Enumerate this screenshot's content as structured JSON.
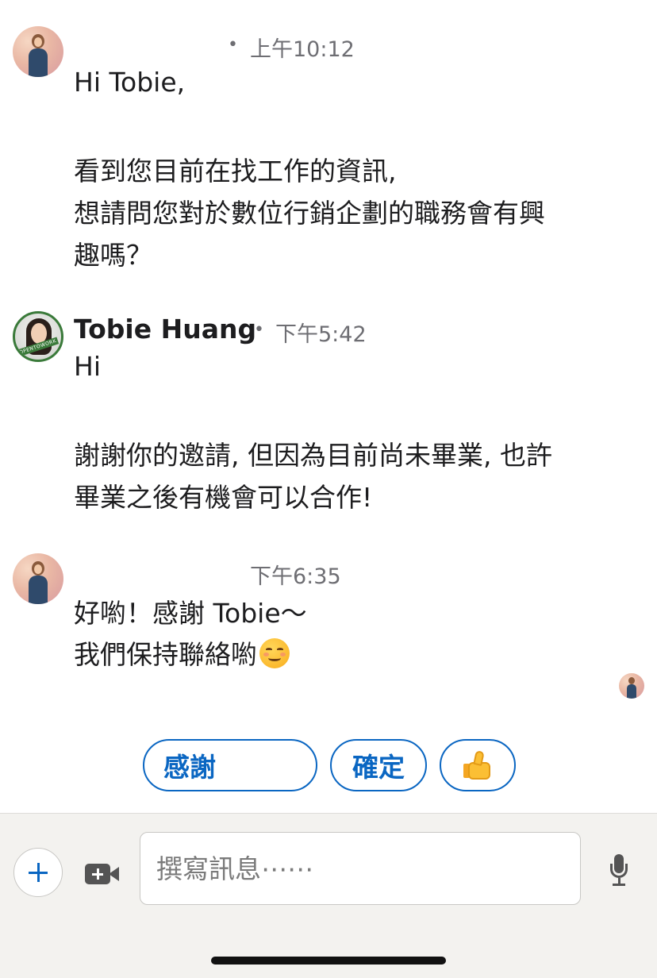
{
  "messages": [
    {
      "sender": "",
      "time": "上午10:12",
      "lines": [
        "Hi Tobie,",
        "看到您目前在找工作的資訊,",
        "想請問您對於數位行銷企劃的職務會有興",
        "趣嗎？"
      ]
    },
    {
      "sender": "Tobie Huang",
      "time": "下午5:42",
      "avatar_badge": "#OPENTOWORK",
      "lines": [
        "Hi",
        "謝謝你的邀請, 但因為目前尚未畢業, 也許",
        "畢業之後有機會可以合作!"
      ]
    },
    {
      "sender": "",
      "time": "下午6:35",
      "lines": [
        "好喲！感謝 Tobie～",
        "我們保持聯絡喲"
      ],
      "emoji": "smiling-face-icon"
    }
  ],
  "quick_replies": [
    "感謝",
    "確定"
  ],
  "quick_reply_icon": "thumbs-up-icon",
  "composer": {
    "placeholder": "撰寫訊息⋯⋯"
  },
  "colors": {
    "accent": "#0a66c2",
    "text": "#1d1d1f",
    "muted": "#6e6e73",
    "composer_bg": "#f3f2ef"
  }
}
